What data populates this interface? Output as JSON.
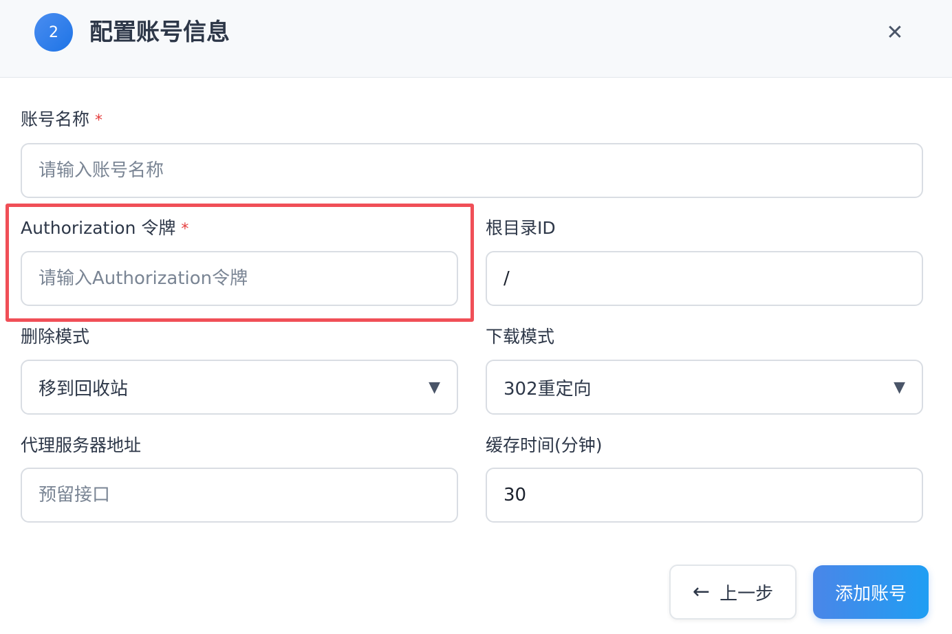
{
  "dialog": {
    "step_number": "2",
    "title": "配置账号信息",
    "close_glyph": "✕"
  },
  "form": {
    "required_mark": "*",
    "account_name": {
      "label": "账号名称",
      "placeholder": "请输入账号名称",
      "value": ""
    },
    "authorization": {
      "label": "Authorization 令牌",
      "placeholder": "请输入Authorization令牌",
      "value": ""
    },
    "root_dir_id": {
      "label": "根目录ID",
      "placeholder": "",
      "value": "/"
    },
    "delete_mode": {
      "label": "删除模式",
      "selected": "移到回收站",
      "caret": "▼"
    },
    "download_mode": {
      "label": "下载模式",
      "selected": "302重定向",
      "caret": "▼"
    },
    "proxy_server": {
      "label": "代理服务器地址",
      "placeholder": "预留接口",
      "value": ""
    },
    "cache_time": {
      "label": "缓存时间(分钟)",
      "placeholder": "",
      "value": "30"
    }
  },
  "actions": {
    "back_arrow": "←",
    "back_label": "上一步",
    "submit_label": "添加账号"
  },
  "colors": {
    "accent": "#1e74e6",
    "required": "#e53e3e",
    "highlight": "#f04f57"
  }
}
